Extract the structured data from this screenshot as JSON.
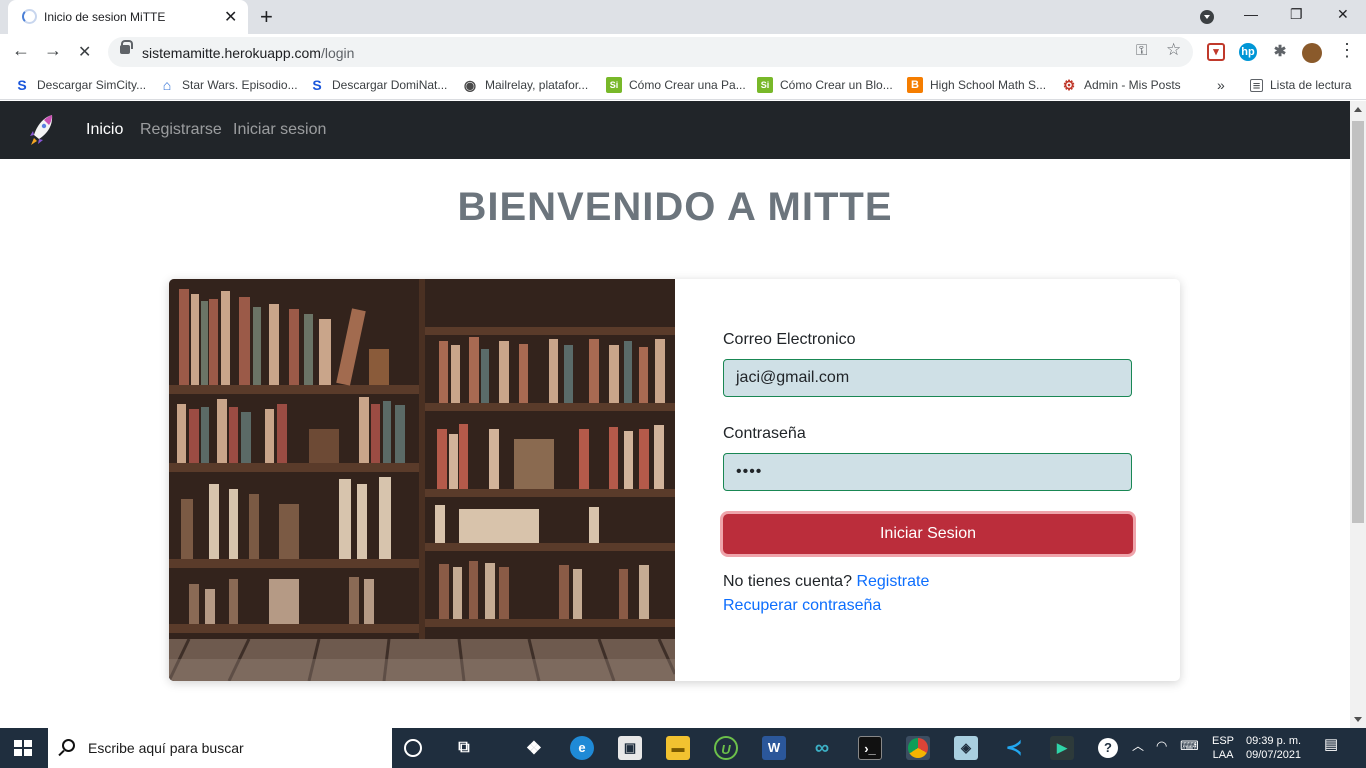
{
  "browser": {
    "tab_title": "Inicio de sesion MiTTE",
    "close_glyph": "✕",
    "newtab_glyph": "+",
    "url_host": "sistemamitte.herokuapp.com",
    "url_path": "/login",
    "back_glyph": "←",
    "forward_glyph": "→",
    "reload_glyph": "✕",
    "more_glyph": "⋮",
    "key_glyph": "⚿",
    "star_glyph": "☆",
    "puzzle_glyph": "✱",
    "ext_hp": "hp",
    "min_glyph": "—",
    "max_glyph": "❐",
    "wclose_glyph": "✕"
  },
  "bookmarks": [
    {
      "label": "Descargar SimCity...",
      "icon": "S",
      "color": "#1a56db"
    },
    {
      "label": "Star Wars. Episodio...",
      "icon": "⌂",
      "color": "#2f6fd6"
    },
    {
      "label": "Descargar DomiNat...",
      "icon": "S",
      "color": "#1a56db"
    },
    {
      "label": "Mailrelay, platafor...",
      "icon": "◉",
      "color": "#4a4a4a"
    },
    {
      "label": "Cómo Crear una Pa...",
      "icon": "Si",
      "color": "#78b829"
    },
    {
      "label": "Cómo Crear un Blo...",
      "icon": "Si",
      "color": "#78b829"
    },
    {
      "label": "High School Math S...",
      "icon": "B",
      "color": "#f57d00"
    },
    {
      "label": "Admin - Mis Posts",
      "icon": "⚙",
      "color": "#c0392b"
    }
  ],
  "bookmarks_more": "»",
  "reading_list": "Lista de lectura",
  "navbar": {
    "links": [
      "Inicio",
      "Registrarse",
      "Iniciar sesion"
    ]
  },
  "page": {
    "heading": "BIENVENIDO A MITTE",
    "email_label": "Correo Electronico",
    "email_value": "jaci@gmail.com",
    "password_label": "Contraseña",
    "password_value": "••••",
    "submit_label": "Iniciar Sesion",
    "no_account_text": "No tienes cuenta?",
    "register_link": "Registrate",
    "recover_link": "Recuperar contraseña"
  },
  "taskbar": {
    "search_placeholder": "Escribe aquí para buscar",
    "lang_top": "ESP",
    "lang_bottom": "LAA",
    "time": "09:39 p. m.",
    "date": "09/07/2021"
  },
  "colors": {
    "navbar_bg": "#212529",
    "primary_button": "#bb2d3b",
    "input_border": "#198754",
    "link": "#0d6efd"
  }
}
